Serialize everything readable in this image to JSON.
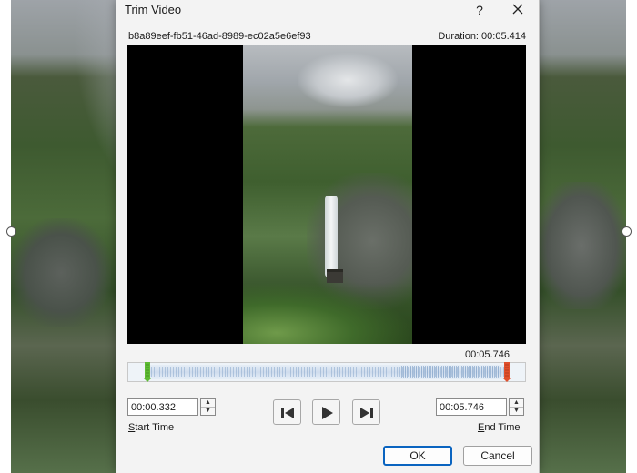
{
  "dialog": {
    "title": "Trim Video",
    "help_label": "?",
    "filename": "b8a89eef-fb51-46ad-8989-ec02a5e6ef93",
    "duration_text": "Duration: 00:05.414",
    "current_time": "00:05.746",
    "start_time": "00:00.332",
    "end_time": "00:05.746",
    "start_label_prefix": "S",
    "start_label_rest": "tart Time",
    "end_label_prefix": "E",
    "end_label_rest": "nd Time",
    "ok_label": "OK",
    "cancel_label": "Cancel",
    "spinner_up": "▲",
    "spinner_down": "▼"
  },
  "colors": {
    "start_marker": "#5dbb33",
    "end_marker": "#e0502c",
    "ok_border": "#0a64c0"
  },
  "icons": {
    "close": "close-icon",
    "previous_frame": "previous-frame-icon",
    "play": "play-icon",
    "next_frame": "next-frame-icon"
  }
}
